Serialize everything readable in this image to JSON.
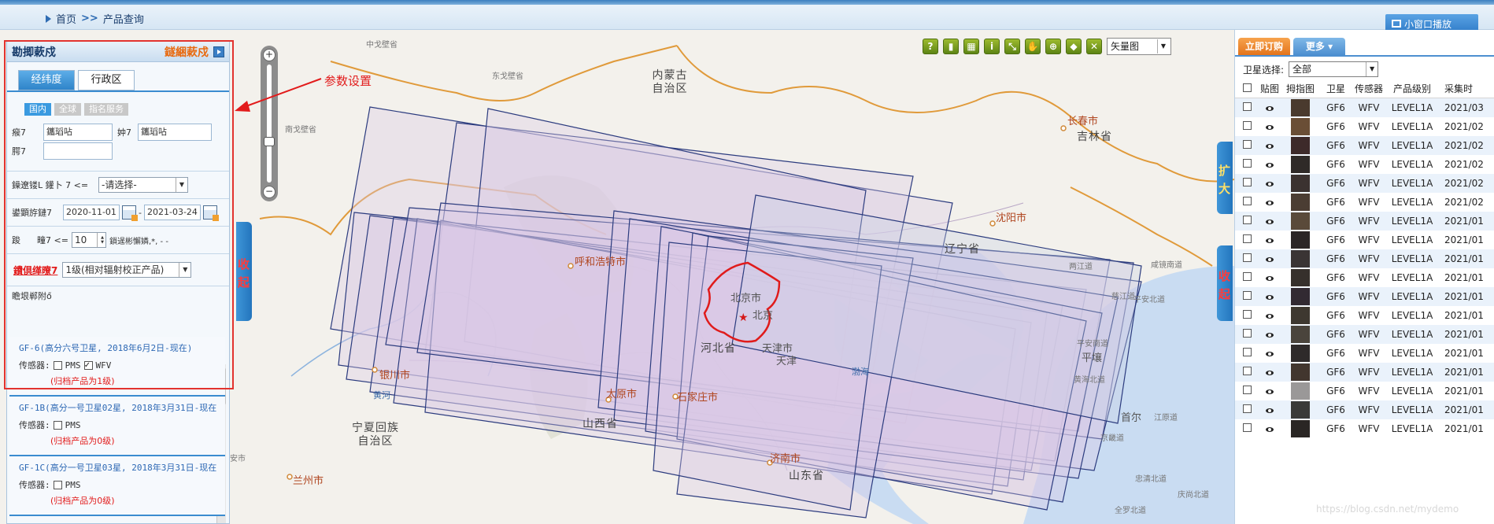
{
  "header": {
    "breadcrumb": [
      "首页",
      "产品查询"
    ],
    "breadcrumb_sep": ">>",
    "small_window_button": "小窗口播放"
  },
  "annotation": {
    "label": "参数设置"
  },
  "left_panel": {
    "title": "勘揤蔌戍",
    "link": "鐩綑蔌戍",
    "tabs": [
      "经纬度",
      "行政区"
    ],
    "active_tab": 1,
    "scope_buttons": [
      "国内",
      "全球",
      "指名服务"
    ],
    "fields": {
      "province_label": "瘊7",
      "province_value": "鑴瑫呫",
      "city_label": "妕7",
      "city_value": "鑴瑫呫",
      "county_label": "腭7",
      "county_value": ""
    },
    "cloud": {
      "label": "鐰遼镂L 鑵卜 7 <=",
      "select": "-请选择-"
    },
    "date": {
      "label": "鍙顕斿鏈7",
      "start": "2020-11-01",
      "end": "2021-03-24",
      "sep": "-"
    },
    "resolution": {
      "label": "踆      疃7 <=",
      "value": "10",
      "unit": "鎻遈彬懈嫾,*, - -"
    },
    "product_level": {
      "label": "鐨倶缂曢7",
      "select": "1级(相对辐射校正产品)"
    },
    "sat_section_label": "瞻垠郸附ő",
    "satellites": [
      {
        "name": "GF-6(高分六号卫星, 2018年6月2日-现在)",
        "sensor_label": "传感器:",
        "sensors": [
          {
            "name": "PMS",
            "checked": false
          },
          {
            "name": "WFV",
            "checked": true
          }
        ],
        "note": "(归档产品为1级)"
      },
      {
        "name": "GF-1B(高分一号卫星02星, 2018年3月31日-现在",
        "sensor_label": "传感器:",
        "sensors": [
          {
            "name": "PMS",
            "checked": false
          }
        ],
        "note": "(归档产品为0级)"
      },
      {
        "name": "GF-1C(高分一号卫星03星, 2018年3月31日-现在",
        "sensor_label": "传感器:",
        "sensors": [
          {
            "name": "PMS",
            "checked": false
          }
        ],
        "note": "(归档产品为0级)"
      }
    ]
  },
  "side_tabs": {
    "left_collapse": "收起",
    "right_expand": "扩大",
    "right_collapse": "收起"
  },
  "map": {
    "basemap": "矢量图",
    "tool_icons": [
      "help-icon",
      "ruler-icon",
      "area-measure-icon",
      "info-icon",
      "fullscreen-icon",
      "pan-hand-icon",
      "locate-icon",
      "polygon-draw-icon",
      "clear-icon"
    ],
    "labels": [
      {
        "text": "中戈壁省",
        "cls": "small"
      },
      {
        "text": "东戈壁省",
        "cls": "small"
      },
      {
        "text": "南戈壁省",
        "cls": "small"
      },
      {
        "text": "内蒙古\n自治区",
        "cls": "big"
      },
      {
        "text": "长春市",
        "cls": "red"
      },
      {
        "text": "吉林省",
        "cls": "big"
      },
      {
        "text": "沈阳市",
        "cls": "red"
      },
      {
        "text": "辽宁省",
        "cls": "big"
      },
      {
        "text": "呼和浩特市",
        "cls": "red"
      },
      {
        "text": "北京市",
        "cls": ""
      },
      {
        "text": "北京",
        "cls": ""
      },
      {
        "text": "河北省",
        "cls": "big"
      },
      {
        "text": "天津市",
        "cls": ""
      },
      {
        "text": "天津",
        "cls": ""
      },
      {
        "text": "银川市",
        "cls": "red"
      },
      {
        "text": "黄河",
        "cls": "blue"
      },
      {
        "text": "太原市",
        "cls": "red"
      },
      {
        "text": "石家庄市",
        "cls": "red"
      },
      {
        "text": "山西省",
        "cls": "big"
      },
      {
        "text": "宁夏回族\n自治区",
        "cls": "big"
      },
      {
        "text": "兰州市",
        "cls": "red"
      },
      {
        "text": "济南市",
        "cls": "red"
      },
      {
        "text": "山东省",
        "cls": "big"
      },
      {
        "text": "平壤",
        "cls": ""
      },
      {
        "text": "首尔",
        "cls": ""
      },
      {
        "text": "渤海",
        "cls": "blue"
      },
      {
        "text": "江原道",
        "cls": "small"
      },
      {
        "text": "平安南道",
        "cls": "small"
      },
      {
        "text": "黄海北道",
        "cls": "small"
      },
      {
        "text": "京畿道",
        "cls": "small"
      },
      {
        "text": "忠清北道",
        "cls": "small"
      },
      {
        "text": "全罗北道",
        "cls": "small"
      },
      {
        "text": "庆尚北道",
        "cls": "small"
      },
      {
        "text": "两江道",
        "cls": "small"
      },
      {
        "text": "慈江道",
        "cls": "small"
      },
      {
        "text": "咸镜南道",
        "cls": "small"
      },
      {
        "text": "平安北道",
        "cls": "small"
      },
      {
        "text": "安市",
        "cls": "small"
      }
    ]
  },
  "right_panel": {
    "order_tab": "立即订购",
    "more_tab": "更多",
    "sat_select_label": "卫星选择:",
    "sat_select_value": "全部",
    "columns": [
      "贴图",
      "拇指图",
      "卫星",
      "传感器",
      "产品级别",
      "采集时"
    ],
    "rows": [
      {
        "sat": "GF6",
        "sensor": "WFV",
        "level": "LEVEL1A",
        "date": "2021/03",
        "thumb": "#4a3a2e"
      },
      {
        "sat": "GF6",
        "sensor": "WFV",
        "level": "LEVEL1A",
        "date": "2021/02",
        "thumb": "#6a4e36"
      },
      {
        "sat": "GF6",
        "sensor": "WFV",
        "level": "LEVEL1A",
        "date": "2021/02",
        "thumb": "#3d2a2a"
      },
      {
        "sat": "GF6",
        "sensor": "WFV",
        "level": "LEVEL1A",
        "date": "2021/02",
        "thumb": "#2f2a28"
      },
      {
        "sat": "GF6",
        "sensor": "WFV",
        "level": "LEVEL1A",
        "date": "2021/02",
        "thumb": "#3b3230"
      },
      {
        "sat": "GF6",
        "sensor": "WFV",
        "level": "LEVEL1A",
        "date": "2021/02",
        "thumb": "#4b3d33"
      },
      {
        "sat": "GF6",
        "sensor": "WFV",
        "level": "LEVEL1A",
        "date": "2021/01",
        "thumb": "#5a4a3a"
      },
      {
        "sat": "GF6",
        "sensor": "WFV",
        "level": "LEVEL1A",
        "date": "2021/01",
        "thumb": "#2c2626"
      },
      {
        "sat": "GF6",
        "sensor": "WFV",
        "level": "LEVEL1A",
        "date": "2021/01",
        "thumb": "#3a3434"
      },
      {
        "sat": "GF6",
        "sensor": "WFV",
        "level": "LEVEL1A",
        "date": "2021/01",
        "thumb": "#36302c"
      },
      {
        "sat": "GF6",
        "sensor": "WFV",
        "level": "LEVEL1A",
        "date": "2021/01",
        "thumb": "#322a32"
      },
      {
        "sat": "GF6",
        "sensor": "WFV",
        "level": "LEVEL1A",
        "date": "2021/01",
        "thumb": "#3e3830"
      },
      {
        "sat": "GF6",
        "sensor": "WFV",
        "level": "LEVEL1A",
        "date": "2021/01",
        "thumb": "#4a443c"
      },
      {
        "sat": "GF6",
        "sensor": "WFV",
        "level": "LEVEL1A",
        "date": "2021/01",
        "thumb": "#2e2a2a"
      },
      {
        "sat": "GF6",
        "sensor": "WFV",
        "level": "LEVEL1A",
        "date": "2021/01",
        "thumb": "#42362e"
      },
      {
        "sat": "GF6",
        "sensor": "WFV",
        "level": "LEVEL1A",
        "date": "2021/01",
        "thumb": "#9a9898"
      },
      {
        "sat": "GF6",
        "sensor": "WFV",
        "level": "LEVEL1A",
        "date": "2021/01",
        "thumb": "#3a3a38"
      },
      {
        "sat": "GF6",
        "sensor": "WFV",
        "level": "LEVEL1A",
        "date": "2021/01",
        "thumb": "#2a2624"
      }
    ]
  },
  "watermark": "https://blog.csdn.net/mydemo"
}
